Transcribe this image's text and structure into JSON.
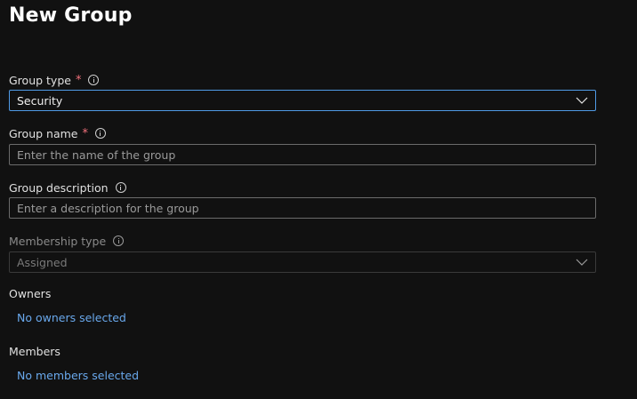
{
  "page": {
    "title": "New Group"
  },
  "group_type": {
    "label": "Group type",
    "required_marker": "*",
    "value": "Security",
    "info_icon": "info-icon"
  },
  "group_name": {
    "label": "Group name",
    "required_marker": "*",
    "placeholder": "Enter the name of the group",
    "info_icon": "info-icon"
  },
  "group_description": {
    "label": "Group description",
    "placeholder": "Enter a description for the group",
    "info_icon": "info-icon"
  },
  "membership_type": {
    "label": "Membership type",
    "value": "Assigned",
    "disabled": true,
    "info_icon": "info-icon"
  },
  "owners": {
    "label": "Owners",
    "link": "No owners selected"
  },
  "members": {
    "label": "Members",
    "link": "No members selected"
  },
  "colors": {
    "background": "#111111",
    "accent_link": "#69a8ec",
    "focus_border": "#4f9ae6",
    "required": "#f1707b"
  }
}
